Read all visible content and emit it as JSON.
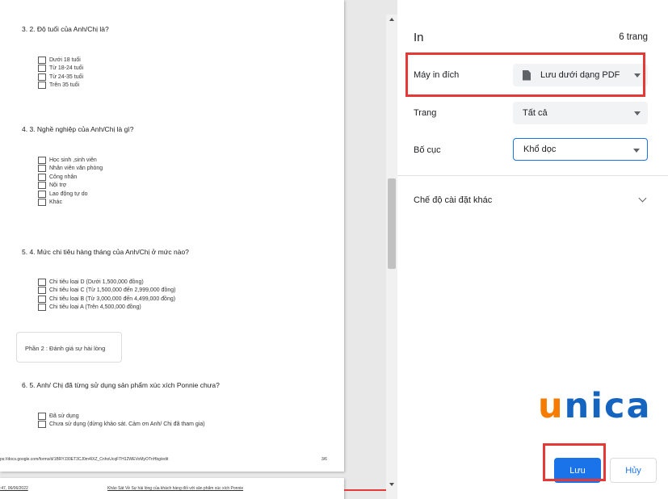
{
  "preview": {
    "questions": [
      {
        "title": "3.   2.   Độ tuổi của Anh/Chị là?",
        "options": [
          "Dưới 18 tuổi",
          "Từ 18-24 tuổi",
          "Từ 24-35 tuổi",
          "Trên 35 tuổi"
        ]
      },
      {
        "title": "4.   3.   Nghề nghiệp của Anh/Chị là gì?",
        "options": [
          "Học sinh ,sinh viên",
          "Nhân viên văn phòng",
          "Công nhân",
          "Nội trợ",
          "Lao động tự do",
          "Khác"
        ]
      },
      {
        "title": "5.   4.   Mức chi tiêu hàng tháng của Anh/Chị ở mức nào?",
        "options": [
          "Chi tiêu loại D (Dưới 1,500,000 đồng)",
          "Chi tiêu loại C (Từ 1,500,000 đến 2,999,000 đồng)",
          "Chi tiêu loại B (Từ 3,000,000 đến 4,499,000 đồng)",
          "Chi tiêu loại A (Trên 4,500,000 đồng)"
        ]
      },
      {
        "title": "6.   5. Anh/ Chị đã từng sử dụng sản phẩm xúc xích Ponnie chưa?",
        "options": [
          "Đã sử dụng",
          "Chưa sử dụng (dừng khảo sát. Cảm ơn Anh/ Chị đã tham gia)"
        ]
      }
    ],
    "section_box": "Phần 2 : Đánh giá sự hài lòng",
    "footer_url": "ps://docs.google.com/forms/d/1BRYJ30ET3CJ0m4IXZ_CnhoUcqFTH12WEVoMyOTnHbg/edit",
    "footer_page": "3/6",
    "page2_date": ":47, 06/06/2022",
    "page2_title": "Khảo Sát Về Sự hài lòng của khách hàng đối với sản phẩm xúc xích Ponnie"
  },
  "panel": {
    "title": "In",
    "page_count": "6 trang",
    "destination": {
      "label": "Máy in đích",
      "value": "Lưu dưới dạng PDF",
      "icon": "document-icon"
    },
    "pages": {
      "label": "Trang",
      "value": "Tất cả"
    },
    "layout": {
      "label": "Bố cục",
      "value": "Khổ dọc"
    },
    "more_settings": "Chế độ cài đặt khác",
    "save_label": "Lưu",
    "cancel_label": "Hủy"
  },
  "logo": {
    "first": "u",
    "rest": "nica"
  },
  "colors": {
    "accent": "#1a73e8",
    "highlight": "#e53935",
    "logo_orange": "#f57c00",
    "logo_blue": "#1565c0"
  }
}
